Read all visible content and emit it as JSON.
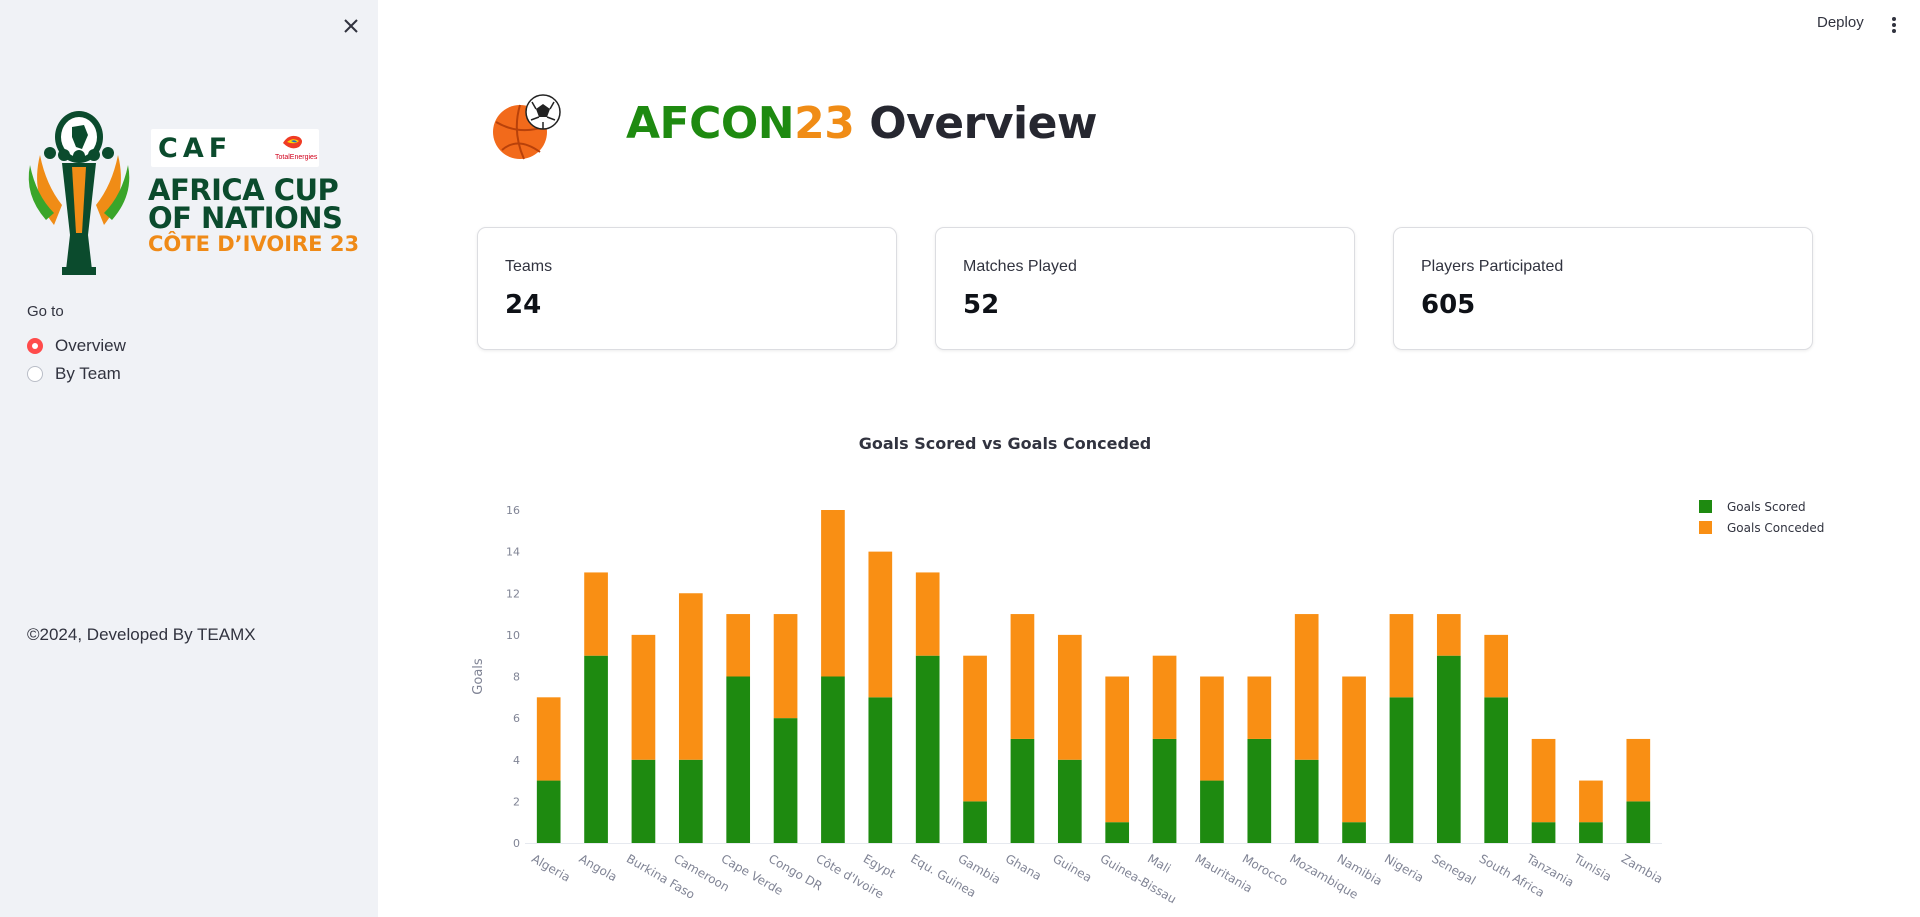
{
  "sidebar": {
    "logo": {
      "caf_text": "CAF",
      "sponsor_text": "TotalEnergies",
      "line1": "AFRICA CUP",
      "line2": "OF NATIONS",
      "line3": "CÔTE D’IVOIRE 23"
    },
    "goto_label": "Go to",
    "options": [
      {
        "label": "Overview",
        "checked": true
      },
      {
        "label": "By Team",
        "checked": false
      }
    ],
    "footer": "©2024, Developed By TEAMX"
  },
  "header": {
    "deploy_label": "Deploy"
  },
  "title": {
    "part1": "AFCON",
    "part2": "23",
    "part3": " Overview"
  },
  "metrics": [
    {
      "label": "Teams",
      "value": "24"
    },
    {
      "label": "Matches Played",
      "value": "52"
    },
    {
      "label": "Players Participated",
      "value": "605"
    }
  ],
  "colors": {
    "green": "#1e8a10",
    "orange": "#f98f14",
    "accent_red": "#ff4b4b"
  },
  "chart_data": {
    "type": "bar",
    "stacked": true,
    "title": "Goals Scored vs Goals Conceded",
    "xlabel": "",
    "ylabel": "Goals",
    "ylim": [
      0,
      16
    ],
    "yticks": [
      0,
      2,
      4,
      6,
      8,
      10,
      12,
      14,
      16
    ],
    "legend_position": "top-right",
    "categories": [
      "Algeria",
      "Angola",
      "Burkina Faso",
      "Cameroon",
      "Cape Verde",
      "Congo DR",
      "Côte d'Ivoire",
      "Egypt",
      "Equ. Guinea",
      "Gambia",
      "Ghana",
      "Guinea",
      "Guinea-Bissau",
      "Mali",
      "Mauritania",
      "Morocco",
      "Mozambique",
      "Namibia",
      "Nigeria",
      "Senegal",
      "South Africa",
      "Tanzania",
      "Tunisia",
      "Zambia"
    ],
    "series": [
      {
        "name": "Goals Scored",
        "color": "#1e8a10",
        "values": [
          3,
          9,
          4,
          4,
          8,
          6,
          8,
          7,
          9,
          2,
          5,
          4,
          1,
          5,
          3,
          5,
          4,
          1,
          7,
          9,
          7,
          1,
          1,
          2
        ]
      },
      {
        "name": "Goals Conceded",
        "color": "#f98f14",
        "values": [
          4,
          4,
          6,
          8,
          3,
          5,
          8,
          7,
          4,
          7,
          6,
          6,
          7,
          4,
          5,
          3,
          7,
          7,
          4,
          2,
          3,
          4,
          2,
          3
        ]
      }
    ]
  }
}
